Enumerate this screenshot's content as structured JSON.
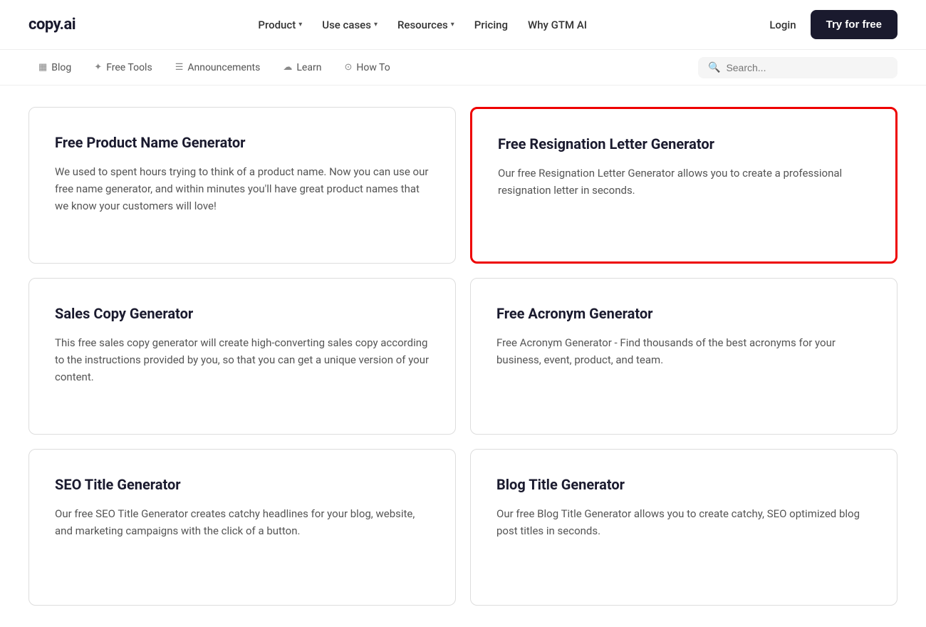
{
  "logo": {
    "text": "copy.ai"
  },
  "topnav": {
    "items": [
      {
        "label": "Product",
        "hasChevron": true
      },
      {
        "label": "Use cases",
        "hasChevron": true
      },
      {
        "label": "Resources",
        "hasChevron": true
      },
      {
        "label": "Pricing",
        "hasChevron": false
      },
      {
        "label": "Why GTM AI",
        "hasChevron": false
      }
    ],
    "login_label": "Login",
    "try_label": "Try for free"
  },
  "subnav": {
    "items": [
      {
        "label": "Blog",
        "icon": "▦"
      },
      {
        "label": "Free Tools",
        "icon": "✦"
      },
      {
        "label": "Announcements",
        "icon": "☰"
      },
      {
        "label": "Learn",
        "icon": "☁"
      },
      {
        "label": "How To",
        "icon": "⊙"
      }
    ],
    "search_placeholder": "Search..."
  },
  "cards": [
    {
      "title": "Free Product Name Generator",
      "description": "We used to spent hours trying to think of a product name. Now you can use our free name generator, and within minutes you'll have great product names that we know your customers will love!",
      "highlighted": false
    },
    {
      "title": "Free Resignation Letter Generator",
      "description": "Our free Resignation Letter Generator allows you to create a professional resignation letter in seconds.",
      "highlighted": true
    },
    {
      "title": "Sales Copy Generator",
      "description": "This free sales copy generator will create high-converting sales copy according to the instructions provided by you, so that you can get a unique version of your content.",
      "highlighted": false
    },
    {
      "title": "Free Acronym Generator",
      "description": "Free Acronym Generator - Find thousands of the best acronyms for your business, event, product, and team.",
      "highlighted": false
    },
    {
      "title": "SEO Title Generator",
      "description": "Our free SEO Title Generator creates catchy headlines for your blog, website, and marketing campaigns with the click of a button.",
      "highlighted": false
    },
    {
      "title": "Blog Title Generator",
      "description": "Our free Blog Title Generator allows you to create catchy, SEO optimized blog post titles in seconds.",
      "highlighted": false
    }
  ]
}
